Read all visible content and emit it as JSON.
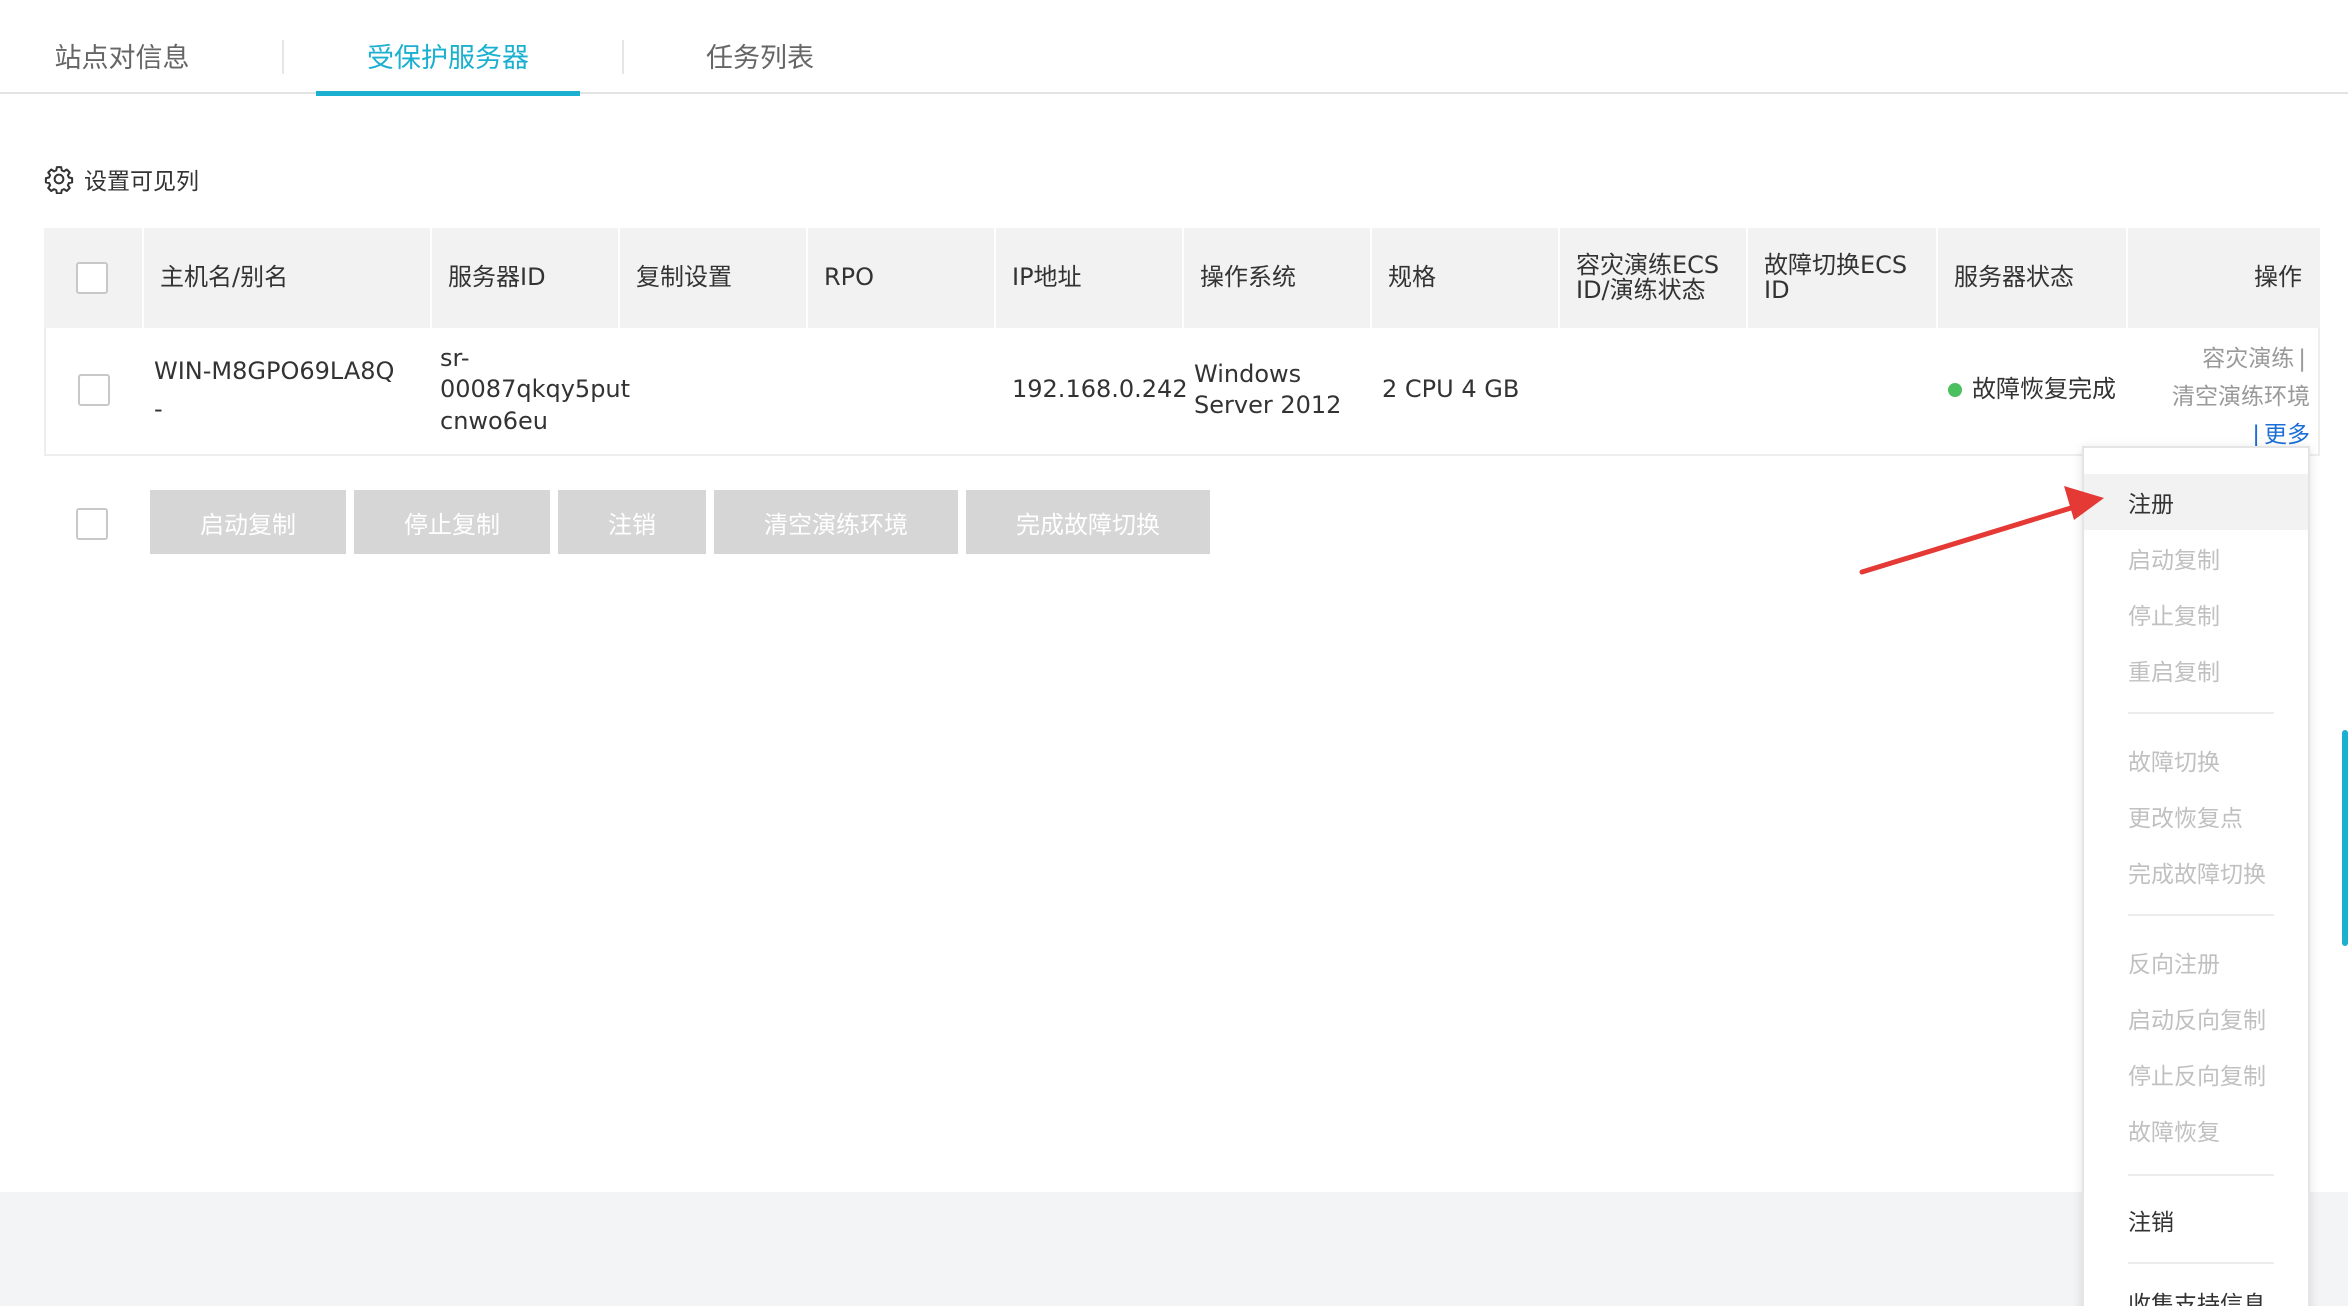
{
  "tabs": [
    {
      "label": "站点对信息",
      "active": false
    },
    {
      "label": "受保护服务器",
      "active": true
    },
    {
      "label": "任务列表",
      "active": false
    }
  ],
  "column_settings": {
    "label": "设置可见列",
    "icon": "gear-icon"
  },
  "table": {
    "headers": {
      "hostname": "主机名/别名",
      "server_id": "服务器ID",
      "replication": "复制设置",
      "rpo": "RPO",
      "ip": "IP地址",
      "os": "操作系统",
      "spec": "规格",
      "drill_ecs_1": "容灾演练ECS",
      "drill_ecs_2": "ID/演练状态",
      "failover_ecs_1": "故障切换ECS",
      "failover_ecs_2": "ID",
      "status": "服务器状态",
      "actions": "操作"
    },
    "rows": [
      {
        "hostname_1": "WIN-M8GPO69LA8Q",
        "hostname_2": "-",
        "server_id_1": "sr-",
        "server_id_2": "00087qkqy5put",
        "server_id_3": "cnwo6eu",
        "ip": "192.168.0.242",
        "os_1": "Windows",
        "os_2": "Server 2012",
        "spec": "2 CPU 4 GB",
        "status": "故障恢复完成",
        "status_color": "#4cbf60",
        "op_drill": "容灾演练",
        "op_clear": "清空演练环境",
        "op_more": "更多",
        "op_sep": "|"
      }
    ]
  },
  "batch_actions": [
    {
      "label": "启动复制"
    },
    {
      "label": "停止复制"
    },
    {
      "label": "注销"
    },
    {
      "label": "清空演练环境"
    },
    {
      "label": "完成故障切换"
    }
  ],
  "more_menu": {
    "items": [
      {
        "label": "注册",
        "enabled": true,
        "hover": true
      },
      {
        "label": "启动复制",
        "enabled": false
      },
      {
        "label": "停止复制",
        "enabled": false
      },
      {
        "label": "重启复制",
        "enabled": false
      },
      {
        "label": "故障切换",
        "enabled": false
      },
      {
        "label": "更改恢复点",
        "enabled": false
      },
      {
        "label": "完成故障切换",
        "enabled": false
      },
      {
        "label": "反向注册",
        "enabled": false
      },
      {
        "label": "启动反向复制",
        "enabled": false
      },
      {
        "label": "停止反向复制",
        "enabled": false
      },
      {
        "label": "故障恢复",
        "enabled": false
      },
      {
        "label": "注销",
        "enabled": true
      },
      {
        "label": "收集支持信息",
        "enabled": true
      }
    ]
  },
  "colors": {
    "accent": "#1bb0d0",
    "link": "#1b6ed6",
    "annotation_arrow": "#e53935"
  }
}
